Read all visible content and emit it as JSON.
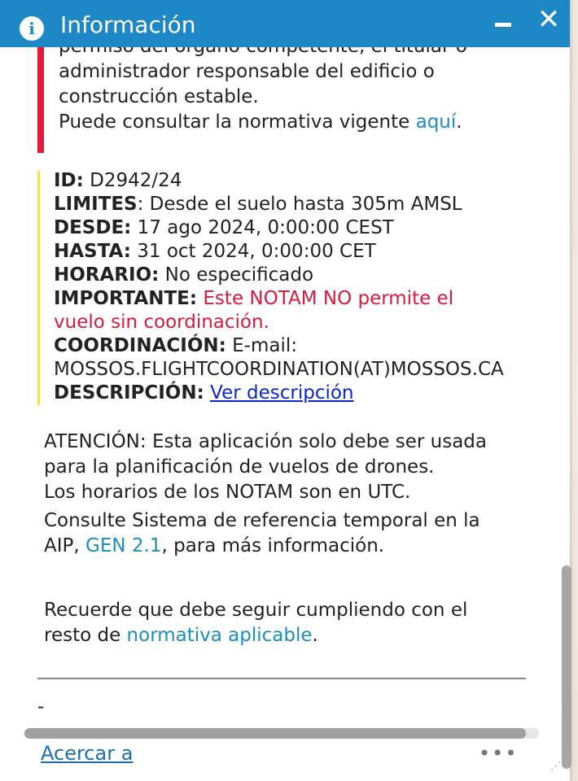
{
  "header": {
    "title": "Información",
    "minimize_label": "–",
    "close_label": "✕"
  },
  "red_block": {
    "cut_line": "permiso del órgano competente, el titular o",
    "line1": "administrador responsable del edificio o",
    "line2": "construcción estable.",
    "line3_prefix": "Puede consultar la normativa vigente ",
    "line3_link": "aquí",
    "line3_suffix": "."
  },
  "notam": {
    "id_label": "ID:",
    "id_value": " D2942/24",
    "limites_label": "LIMITES",
    "limites_value": ": Desde el suelo hasta 305m AMSL",
    "desde_label": "DESDE:",
    "desde_value": " 17 ago 2024, 0:00:00 CEST",
    "hasta_label": "HASTA:",
    "hasta_value": " 31 oct 2024, 0:00:00 CET",
    "horario_label": "HORARIO:",
    "horario_value": " No especificado",
    "importante_label": "IMPORTANTE:",
    "importante_value_1": " Este NOTAM NO permite el",
    "importante_value_2": "vuelo sin coordinación.",
    "coordinacion_label": "COORDINACIÓN:",
    "coordinacion_value": " E-mail:",
    "email": "MOSSOS.FLIGHTCOORDINATION(AT)MOSSOS.CA",
    "descripcion_label": "DESCRIPCIÓN:",
    "descripcion_link": "Ver descripción"
  },
  "attention": {
    "line1": "ATENCIÓN: Esta aplicación solo debe ser usada",
    "line2": "para la planificación de vuelos de drones.",
    "line3": "Los horarios de los NOTAM son en UTC.",
    "line4": "Consulte Sistema de referencia temporal en la",
    "line5_prefix": "AIP, ",
    "line5_link": "GEN 2.1",
    "line5_suffix": ", para más información.",
    "line6": "Recuerde que debe seguir cumpliendo con el",
    "line7_prefix": "resto de ",
    "line7_link": "normativa aplicable",
    "line7_suffix": "."
  },
  "dash": "-",
  "footer": {
    "zoom_link": "Acercar a",
    "more_label": "•••"
  },
  "colors": {
    "header": "#1e88c7",
    "red_bar": "#e01e3c",
    "yellow_bar": "#f2e73a",
    "link": "#1a8ec0",
    "warning_text": "#d81a3c"
  }
}
